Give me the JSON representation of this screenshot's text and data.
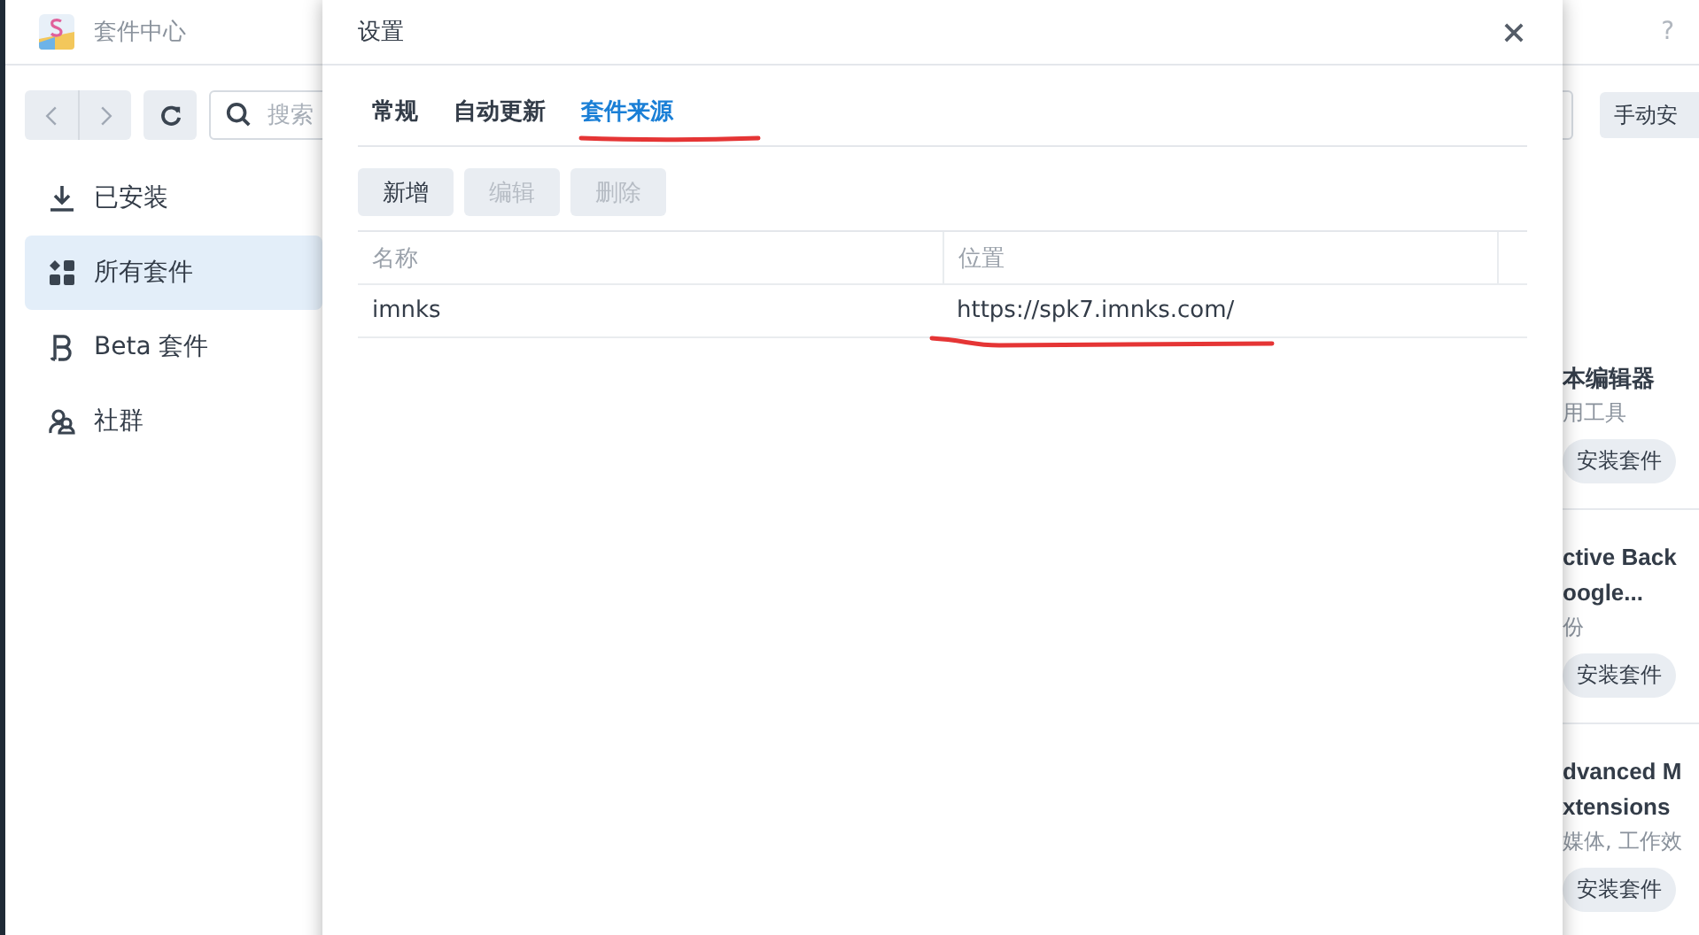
{
  "app": {
    "title": "套件中心",
    "help": "?"
  },
  "toolbar": {
    "search": {
      "placeholder": "搜索"
    },
    "button": "手动安"
  },
  "sidebar": {
    "items": [
      {
        "kind": "download",
        "label": "已安装",
        "selected": false
      },
      {
        "kind": "grid",
        "label": "所有套件",
        "selected": true
      },
      {
        "kind": "beta",
        "label": "Beta 套件",
        "selected": false
      },
      {
        "kind": "community",
        "label": "社群",
        "selected": false
      }
    ]
  },
  "packages": [
    {
      "name": [
        "本编辑器"
      ],
      "category": "用工具",
      "button": "安装套件"
    },
    {
      "name": [
        "ctive Back",
        "oogle..."
      ],
      "category": "份",
      "button": "安装套件"
    },
    {
      "name": [
        "dvanced M",
        "xtensions"
      ],
      "category": "媒体, 工作效",
      "button": "安装套件"
    }
  ],
  "dialog": {
    "title": "设置",
    "tabs": [
      {
        "label": "常规",
        "selected": false
      },
      {
        "label": "自动更新",
        "selected": false
      },
      {
        "label": "套件来源",
        "selected": true
      }
    ],
    "buttons": [
      {
        "label": "新增",
        "disabled": false
      },
      {
        "label": "编辑",
        "disabled": true
      },
      {
        "label": "删除",
        "disabled": true
      }
    ],
    "table": {
      "columns": [
        "名称",
        "位置"
      ],
      "rows": [
        [
          "imnks",
          "https://spk7.imnks.com/"
        ]
      ]
    }
  }
}
